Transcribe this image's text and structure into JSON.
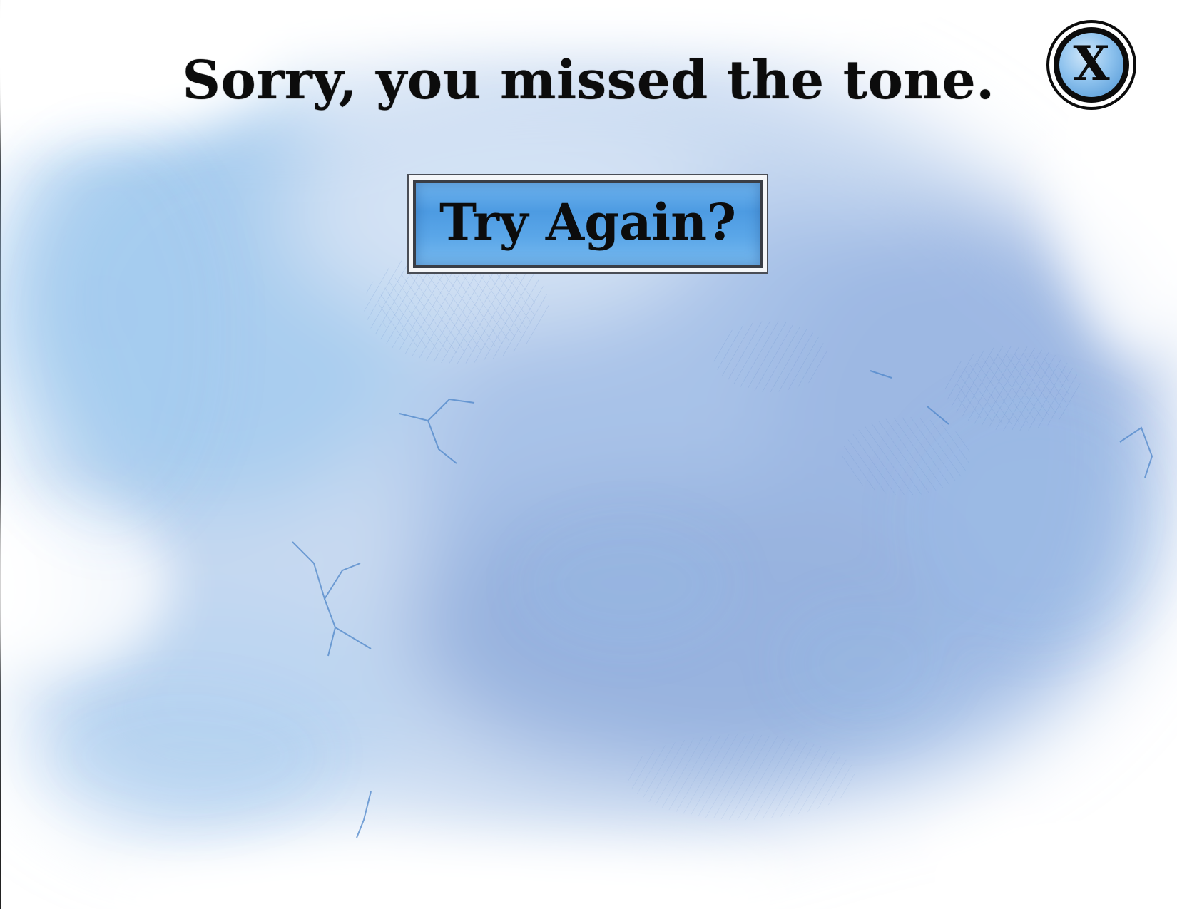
{
  "dialog": {
    "message": "Sorry, you missed the tone.",
    "retry_label": "Try Again?",
    "close_label": "X"
  },
  "icons": {
    "close": "close-icon"
  },
  "colors": {
    "background": "#ffffff",
    "wash_light": "#dbe8f7",
    "wash_mid": "#a9c6ea",
    "wash_dark": "#7ea7dd",
    "button_blue": "#4d9be2",
    "text": "#0c0c0c"
  }
}
